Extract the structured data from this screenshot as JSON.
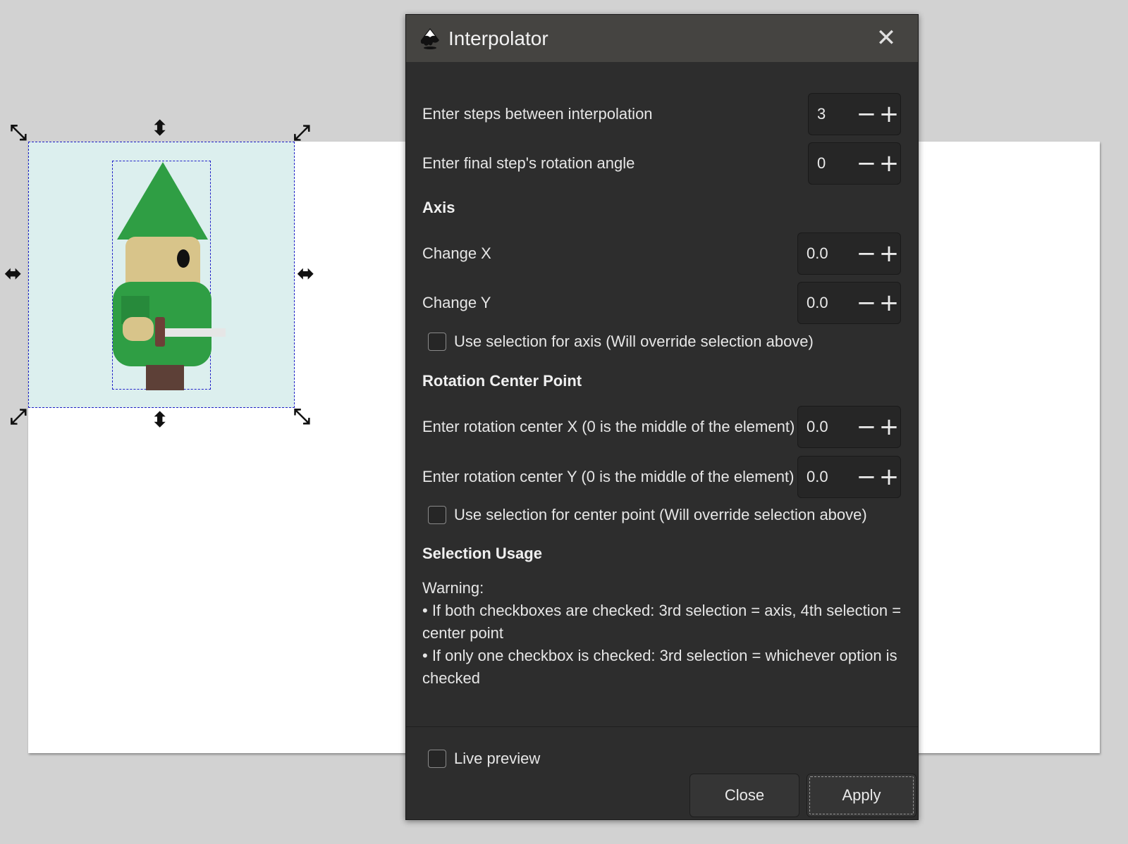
{
  "dialog": {
    "title": "Interpolator",
    "close_icon": "close-icon",
    "fields": {
      "steps": {
        "label": "Enter steps between interpolation",
        "value": "3"
      },
      "rotation": {
        "label": "Enter final step's rotation angle",
        "value": "0"
      },
      "change_x": {
        "label": "Change X",
        "value": "0.0"
      },
      "change_y": {
        "label": "Change Y",
        "value": "0.0"
      },
      "center_x": {
        "label": "Enter rotation center X (0 is the middle of the element)",
        "value": "0.0"
      },
      "center_y": {
        "label": "Enter rotation center Y (0 is the middle of the element)",
        "value": "0.0"
      }
    },
    "spin": {
      "minus": "−",
      "plus": "+"
    },
    "sections": {
      "axis": "Axis",
      "rotation_center": "Rotation Center Point",
      "selection_usage": "Selection Usage"
    },
    "checks": {
      "axis_selection": {
        "label": "Use selection for axis (Will override selection above)",
        "checked": false
      },
      "center_selection": {
        "label": "Use selection for center point (Will override selection above)",
        "checked": false
      },
      "live_preview": {
        "label": "Live preview",
        "checked": false
      }
    },
    "warning": {
      "heading": "Warning:",
      "line1": "• If both checkboxes are checked: 3rd selection = axis, 4th selection = center point",
      "line2": "• If only one checkbox is checked: 3rd selection = whichever option is checked"
    },
    "buttons": {
      "close": "Close",
      "apply": "Apply"
    }
  },
  "canvas": {
    "selection_fill": "#dcefee",
    "selection_border": "#2020c8",
    "gnome": {
      "hat": "#2f9e44",
      "face": "#d8c48a",
      "body": "#2f9e44",
      "legs": "#5d4037",
      "sword": "#e6e6e6"
    }
  },
  "colors": {
    "dialog_bg": "#2d2d2d",
    "titlebar_bg": "#454441",
    "page_bg": "#d2d2d2"
  }
}
